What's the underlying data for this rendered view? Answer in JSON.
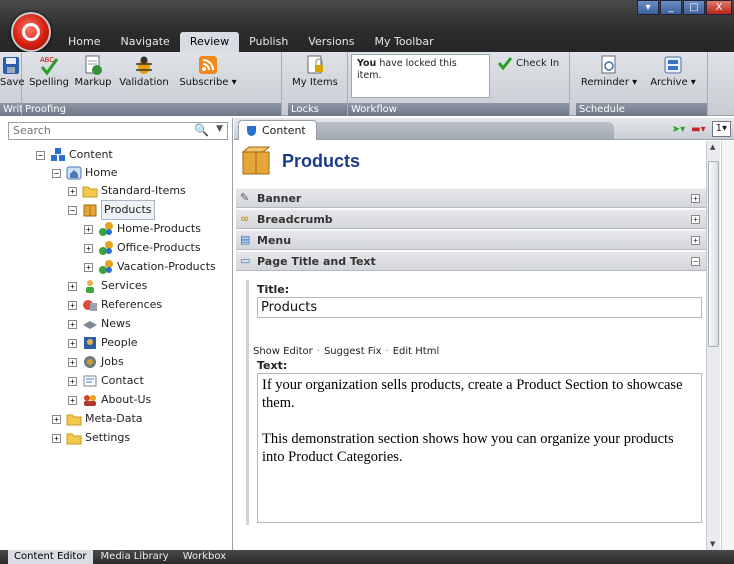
{
  "window": {
    "controls": [
      "▾",
      "_",
      "□",
      "X"
    ]
  },
  "menu_tabs": [
    "Home",
    "Navigate",
    "Review",
    "Publish",
    "Versions",
    "My Toolbar"
  ],
  "active_menu_tab": "Review",
  "ribbon": {
    "write": {
      "save": "Save",
      "group": "Write"
    },
    "proofing": {
      "spelling": "Spelling",
      "markup": "Markup",
      "validation": "Validation",
      "subscribe": "Subscribe",
      "group": "Proofing"
    },
    "locks": {
      "my_items": "My Items",
      "group": "Locks"
    },
    "workflow": {
      "lock_bold": "You",
      "lock_text": " have locked this item.",
      "check_in": "Check In",
      "group": "Workflow"
    },
    "schedule": {
      "reminder": "Reminder",
      "archive": "Archive",
      "group": "Schedule"
    }
  },
  "search": {
    "placeholder": "Search"
  },
  "tree": [
    {
      "label": "Content",
      "icon": "content-icon"
    },
    {
      "label": "Home",
      "icon": "home-icon"
    },
    {
      "label": "Standard-Items",
      "icon": "folder-icon"
    },
    {
      "label": "Products",
      "icon": "box-icon"
    },
    {
      "label": "Home-Products",
      "icon": "gear-group-icon"
    },
    {
      "label": "Office-Products",
      "icon": "gear-group-icon"
    },
    {
      "label": "Vacation-Products",
      "icon": "gear-group-icon"
    },
    {
      "label": "Services",
      "icon": "person-icon"
    },
    {
      "label": "References",
      "icon": "award-icon"
    },
    {
      "label": "News",
      "icon": "news-icon"
    },
    {
      "label": "People",
      "icon": "people-icon"
    },
    {
      "label": "Jobs",
      "icon": "briefcase-icon"
    },
    {
      "label": "Contact",
      "icon": "contact-icon"
    },
    {
      "label": "About-Us",
      "icon": "group-icon"
    },
    {
      "label": "Meta-Data",
      "icon": "folder-icon"
    },
    {
      "label": "Settings",
      "icon": "folder-icon"
    }
  ],
  "editor": {
    "tab_label": "Content",
    "page_number": "1",
    "item_title": "Products",
    "sections": [
      {
        "label": "Banner",
        "toggle": "+"
      },
      {
        "label": "Breadcrumb",
        "toggle": "+"
      },
      {
        "label": "Menu",
        "toggle": "+"
      },
      {
        "label": "Page Title and Text",
        "toggle": "−"
      }
    ],
    "title_label": "Title:",
    "title_value": "Products",
    "links": [
      "Show Editor",
      "Suggest Fix",
      "Edit Html"
    ],
    "text_label": "Text:",
    "text_paragraphs": [
      "If your organization sells products, create a Product Section to showcase them.",
      "This demonstration section shows how you can organize your products into Product Categories."
    ]
  },
  "bottom_tabs": [
    "Content Editor",
    "Media Library",
    "Workbox"
  ],
  "active_bottom_tab": "Content Editor"
}
